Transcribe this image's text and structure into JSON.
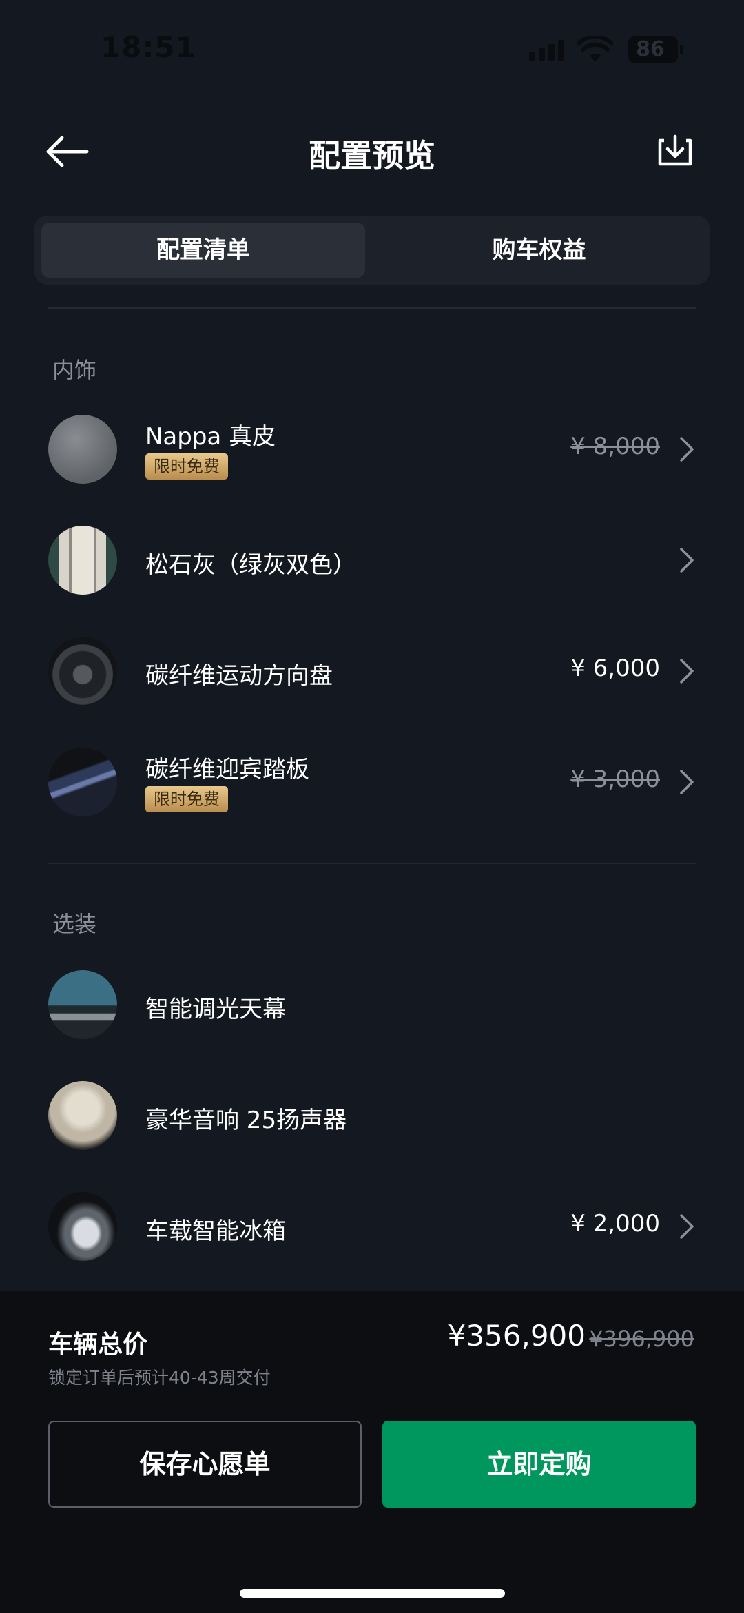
{
  "status_bar": {
    "time": "18:51",
    "battery": "86"
  },
  "header": {
    "title": "配置预览"
  },
  "tabs": [
    {
      "label": "配置清单",
      "active": true
    },
    {
      "label": "购车权益",
      "active": false
    }
  ],
  "sections": {
    "interior": {
      "title": "内饰",
      "items": [
        {
          "name": "Nappa 真皮",
          "badge": "限时免费",
          "price": "¥ 8,000",
          "price_struck": true
        },
        {
          "name": "松石灰（绿灰双色）",
          "price": ""
        },
        {
          "name": "碳纤维运动方向盘",
          "price": "¥ 6,000"
        },
        {
          "name": "碳纤维迎宾踏板",
          "badge": "限时免费",
          "price": "¥ 3,000",
          "price_struck": true
        }
      ]
    },
    "options": {
      "title": "选装",
      "items": [
        {
          "name": "智能调光天幕"
        },
        {
          "name": "豪华音响 25扬声器"
        },
        {
          "name": "车载智能冰箱",
          "price": "¥ 2,000"
        }
      ]
    }
  },
  "bottom_bar": {
    "total_label": "车辆总价",
    "delivery_note": "锁定订单后预计40-43周交付",
    "total_price": "¥356,900",
    "original_price": "¥396,900",
    "wishlist_label": "保存心愿单",
    "order_label": "立即定购"
  },
  "colors": {
    "background": "#141820",
    "accent_green": "#00975e",
    "badge_gold": "#d4aa6a"
  },
  "icons": {
    "back": "arrow-left-icon",
    "download": "download-icon",
    "chevron": "chevron-right-icon"
  }
}
